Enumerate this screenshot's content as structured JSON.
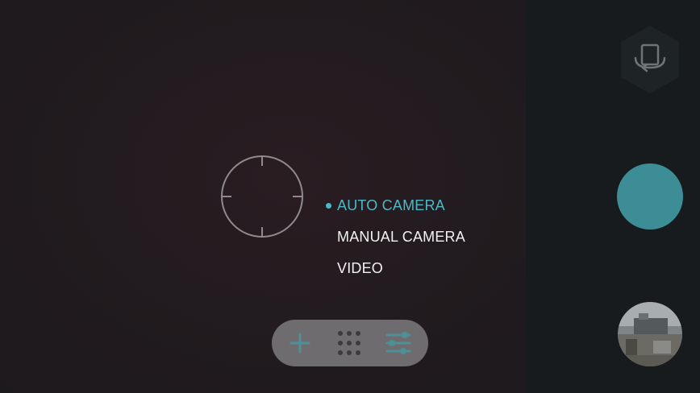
{
  "camera_modes": {
    "items": [
      {
        "label": "AUTO CAMERA",
        "active": true
      },
      {
        "label": "MANUAL CAMERA",
        "active": false
      },
      {
        "label": "VIDEO",
        "active": false
      }
    ]
  },
  "toolbar": {
    "icons": [
      "plus-icon",
      "grid-dots-icon",
      "settings-sliders-icon"
    ]
  },
  "sidebar": {
    "icons": [
      "switch-camera-icon",
      "shutter-button",
      "gallery-thumbnail"
    ]
  },
  "colors": {
    "accent": "#4fb8c6",
    "shutter": "#3d8d96",
    "viewfinder_bg": "#221b1f",
    "sidebar_bg": "#171b1d",
    "toolbar_bg": "#6e6c6f",
    "mode_text": "#f2f2f2"
  }
}
